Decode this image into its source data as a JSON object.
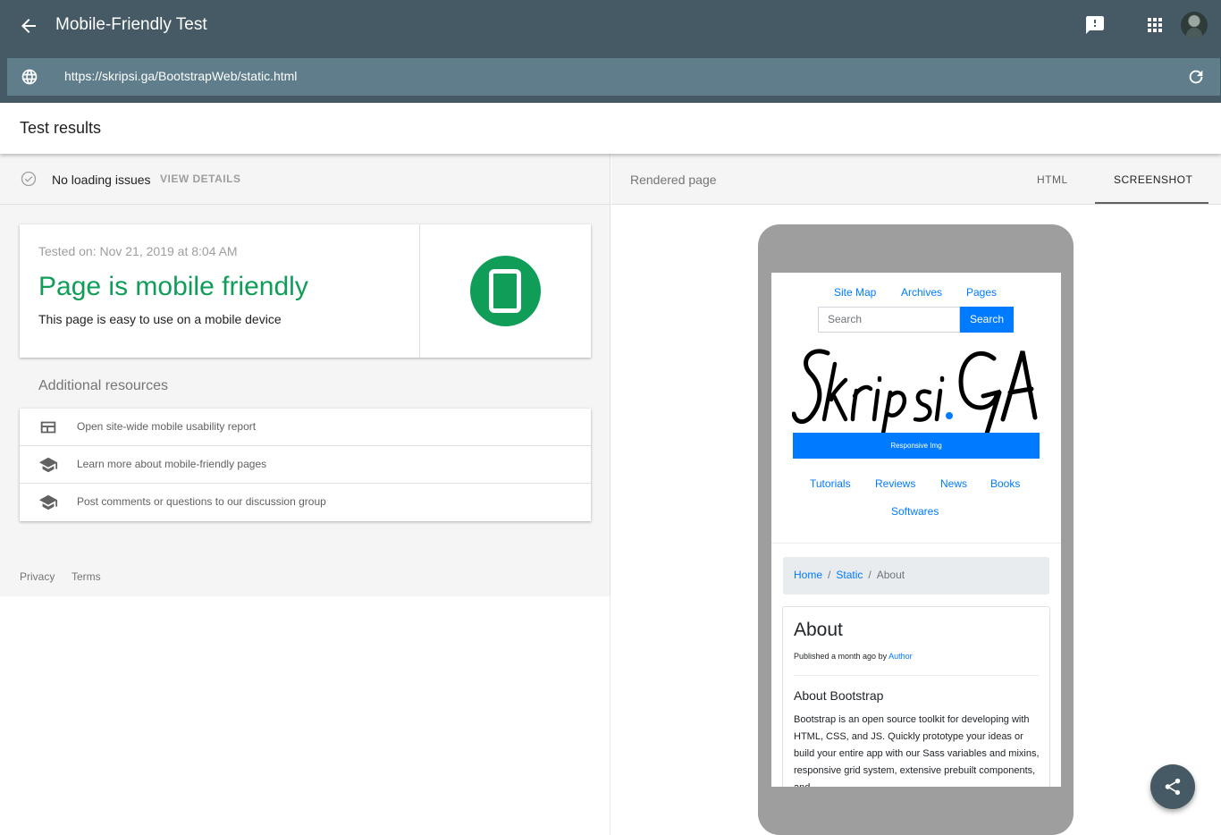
{
  "header": {
    "title": "Mobile-Friendly Test",
    "url": "https://skripsi.ga/BootstrapWeb/static.html",
    "icons": [
      "back-arrow-icon",
      "feedback-icon",
      "apps-grid-icon",
      "avatar",
      "globe-icon",
      "reload-icon"
    ]
  },
  "results_bar": {
    "title": "Test results"
  },
  "status": {
    "text": "No loading issues",
    "link": "VIEW DETAILS"
  },
  "result_card": {
    "tested_on": "Tested on: Nov 21, 2019 at 8:04 AM",
    "verdict": "Page is mobile friendly",
    "subtitle": "This page is easy to use on a mobile device",
    "color": "#0f9d58"
  },
  "resources": {
    "heading": "Additional resources",
    "items": [
      {
        "label": "Open site-wide mobile usability report",
        "icon": "report-icon"
      },
      {
        "label": "Learn more about mobile-friendly pages",
        "icon": "school-icon"
      },
      {
        "label": "Post comments or questions to our discussion group",
        "icon": "school-icon"
      }
    ]
  },
  "footer": {
    "privacy": "Privacy",
    "terms": "Terms"
  },
  "preview": {
    "heading": "Rendered page",
    "tabs": [
      "HTML",
      "SCREENSHOT"
    ],
    "active_tab": "SCREENSHOT"
  },
  "site": {
    "top_nav": [
      "Site Map",
      "Archives",
      "Pages"
    ],
    "search_placeholder": "Search",
    "search_button": "Search",
    "logo_text": "Skripsi.GA",
    "responsive_label": "Responsive Img",
    "nav": [
      "Tutorials",
      "Reviews",
      "News",
      "Books",
      "Softwares"
    ],
    "breadcrumb": [
      "Home",
      "Static",
      "About"
    ],
    "article": {
      "title": "About",
      "published": "Published a month ago by",
      "author": "Author",
      "subtitle": "About Bootstrap",
      "body": "Bootstrap is an open source toolkit for developing with HTML, CSS, and JS. Quickly prototype your ideas or build your entire app with our Sass variables and mixins, responsive grid system, extensive prebuilt components, and"
    }
  },
  "colors": {
    "header_bg": "#455a64",
    "url_bar_bg": "#607d8b",
    "link_blue": "#007bff"
  }
}
